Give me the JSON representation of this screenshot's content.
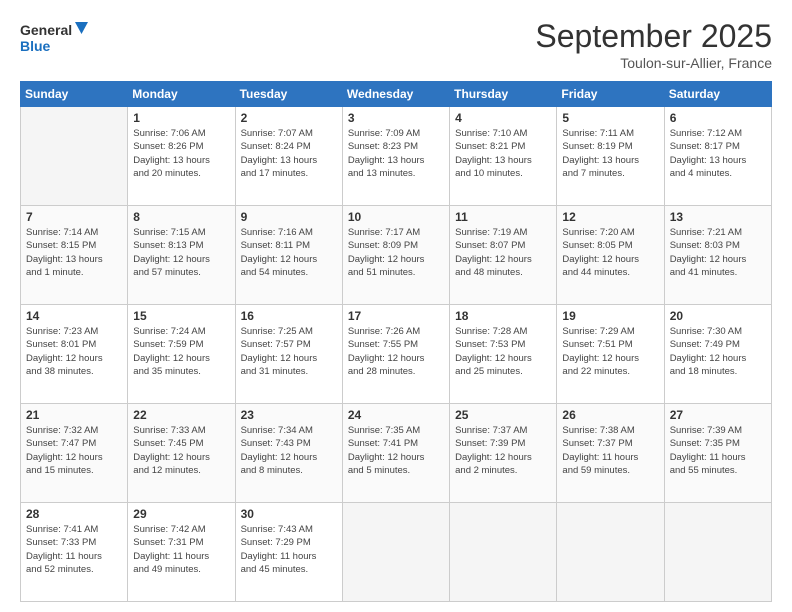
{
  "header": {
    "logo_line1": "General",
    "logo_line2": "Blue",
    "month": "September 2025",
    "location": "Toulon-sur-Allier, France"
  },
  "days_of_week": [
    "Sunday",
    "Monday",
    "Tuesday",
    "Wednesday",
    "Thursday",
    "Friday",
    "Saturday"
  ],
  "weeks": [
    [
      {
        "num": "",
        "info": ""
      },
      {
        "num": "1",
        "info": "Sunrise: 7:06 AM\nSunset: 8:26 PM\nDaylight: 13 hours\nand 20 minutes."
      },
      {
        "num": "2",
        "info": "Sunrise: 7:07 AM\nSunset: 8:24 PM\nDaylight: 13 hours\nand 17 minutes."
      },
      {
        "num": "3",
        "info": "Sunrise: 7:09 AM\nSunset: 8:23 PM\nDaylight: 13 hours\nand 13 minutes."
      },
      {
        "num": "4",
        "info": "Sunrise: 7:10 AM\nSunset: 8:21 PM\nDaylight: 13 hours\nand 10 minutes."
      },
      {
        "num": "5",
        "info": "Sunrise: 7:11 AM\nSunset: 8:19 PM\nDaylight: 13 hours\nand 7 minutes."
      },
      {
        "num": "6",
        "info": "Sunrise: 7:12 AM\nSunset: 8:17 PM\nDaylight: 13 hours\nand 4 minutes."
      }
    ],
    [
      {
        "num": "7",
        "info": "Sunrise: 7:14 AM\nSunset: 8:15 PM\nDaylight: 13 hours\nand 1 minute."
      },
      {
        "num": "8",
        "info": "Sunrise: 7:15 AM\nSunset: 8:13 PM\nDaylight: 12 hours\nand 57 minutes."
      },
      {
        "num": "9",
        "info": "Sunrise: 7:16 AM\nSunset: 8:11 PM\nDaylight: 12 hours\nand 54 minutes."
      },
      {
        "num": "10",
        "info": "Sunrise: 7:17 AM\nSunset: 8:09 PM\nDaylight: 12 hours\nand 51 minutes."
      },
      {
        "num": "11",
        "info": "Sunrise: 7:19 AM\nSunset: 8:07 PM\nDaylight: 12 hours\nand 48 minutes."
      },
      {
        "num": "12",
        "info": "Sunrise: 7:20 AM\nSunset: 8:05 PM\nDaylight: 12 hours\nand 44 minutes."
      },
      {
        "num": "13",
        "info": "Sunrise: 7:21 AM\nSunset: 8:03 PM\nDaylight: 12 hours\nand 41 minutes."
      }
    ],
    [
      {
        "num": "14",
        "info": "Sunrise: 7:23 AM\nSunset: 8:01 PM\nDaylight: 12 hours\nand 38 minutes."
      },
      {
        "num": "15",
        "info": "Sunrise: 7:24 AM\nSunset: 7:59 PM\nDaylight: 12 hours\nand 35 minutes."
      },
      {
        "num": "16",
        "info": "Sunrise: 7:25 AM\nSunset: 7:57 PM\nDaylight: 12 hours\nand 31 minutes."
      },
      {
        "num": "17",
        "info": "Sunrise: 7:26 AM\nSunset: 7:55 PM\nDaylight: 12 hours\nand 28 minutes."
      },
      {
        "num": "18",
        "info": "Sunrise: 7:28 AM\nSunset: 7:53 PM\nDaylight: 12 hours\nand 25 minutes."
      },
      {
        "num": "19",
        "info": "Sunrise: 7:29 AM\nSunset: 7:51 PM\nDaylight: 12 hours\nand 22 minutes."
      },
      {
        "num": "20",
        "info": "Sunrise: 7:30 AM\nSunset: 7:49 PM\nDaylight: 12 hours\nand 18 minutes."
      }
    ],
    [
      {
        "num": "21",
        "info": "Sunrise: 7:32 AM\nSunset: 7:47 PM\nDaylight: 12 hours\nand 15 minutes."
      },
      {
        "num": "22",
        "info": "Sunrise: 7:33 AM\nSunset: 7:45 PM\nDaylight: 12 hours\nand 12 minutes."
      },
      {
        "num": "23",
        "info": "Sunrise: 7:34 AM\nSunset: 7:43 PM\nDaylight: 12 hours\nand 8 minutes."
      },
      {
        "num": "24",
        "info": "Sunrise: 7:35 AM\nSunset: 7:41 PM\nDaylight: 12 hours\nand 5 minutes."
      },
      {
        "num": "25",
        "info": "Sunrise: 7:37 AM\nSunset: 7:39 PM\nDaylight: 12 hours\nand 2 minutes."
      },
      {
        "num": "26",
        "info": "Sunrise: 7:38 AM\nSunset: 7:37 PM\nDaylight: 11 hours\nand 59 minutes."
      },
      {
        "num": "27",
        "info": "Sunrise: 7:39 AM\nSunset: 7:35 PM\nDaylight: 11 hours\nand 55 minutes."
      }
    ],
    [
      {
        "num": "28",
        "info": "Sunrise: 7:41 AM\nSunset: 7:33 PM\nDaylight: 11 hours\nand 52 minutes."
      },
      {
        "num": "29",
        "info": "Sunrise: 7:42 AM\nSunset: 7:31 PM\nDaylight: 11 hours\nand 49 minutes."
      },
      {
        "num": "30",
        "info": "Sunrise: 7:43 AM\nSunset: 7:29 PM\nDaylight: 11 hours\nand 45 minutes."
      },
      {
        "num": "",
        "info": ""
      },
      {
        "num": "",
        "info": ""
      },
      {
        "num": "",
        "info": ""
      },
      {
        "num": "",
        "info": ""
      }
    ]
  ]
}
